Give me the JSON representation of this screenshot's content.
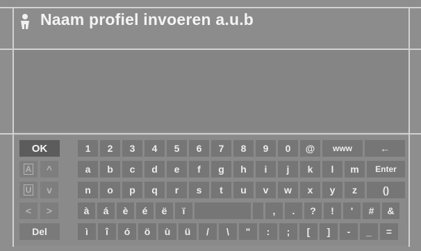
{
  "title": {
    "text": "Naam profiel invoeren a.u.b",
    "icon": "person-icon"
  },
  "input": {
    "value": ""
  },
  "side_keys": [
    {
      "name": "ok-key",
      "label": "OK",
      "icon": ""
    },
    {
      "name": "letter-mode-key",
      "label": "",
      "icon": "letter-a-icon"
    },
    {
      "name": "up-arrow-key",
      "label": "^",
      "icon": ""
    },
    {
      "name": "shift-mode-key",
      "label": "",
      "icon": "letter-u-icon"
    },
    {
      "name": "down-arrow-key",
      "label": "v",
      "icon": ""
    },
    {
      "name": "left-arrow-key",
      "label": "<",
      "icon": ""
    },
    {
      "name": "right-arrow-key",
      "label": ">",
      "icon": ""
    },
    {
      "name": "delete-key",
      "label": "Del",
      "icon": ""
    }
  ],
  "rows": [
    [
      "1",
      "2",
      "3",
      "4",
      "5",
      "6",
      "7",
      "8",
      "9",
      "0",
      "@",
      "www",
      "←"
    ],
    [
      "a",
      "b",
      "c",
      "d",
      "e",
      "f",
      "g",
      "h",
      "i",
      "j",
      "k",
      "l",
      "m",
      "Enter"
    ],
    [
      "n",
      "o",
      "p",
      "q",
      "r",
      "s",
      "t",
      "u",
      "v",
      "w",
      "x",
      "y",
      "z",
      "()"
    ],
    [
      "à",
      "á",
      "è",
      "é",
      "ë",
      "ï",
      "",
      "",
      ",",
      ".",
      "?",
      "!",
      "'",
      "#",
      "&"
    ],
    [
      "ì",
      "î",
      "ó",
      "ö",
      "ù",
      "ü",
      "/",
      "\\",
      "\"",
      ":",
      ";",
      "[",
      "]",
      "-",
      "_",
      "="
    ]
  ]
}
